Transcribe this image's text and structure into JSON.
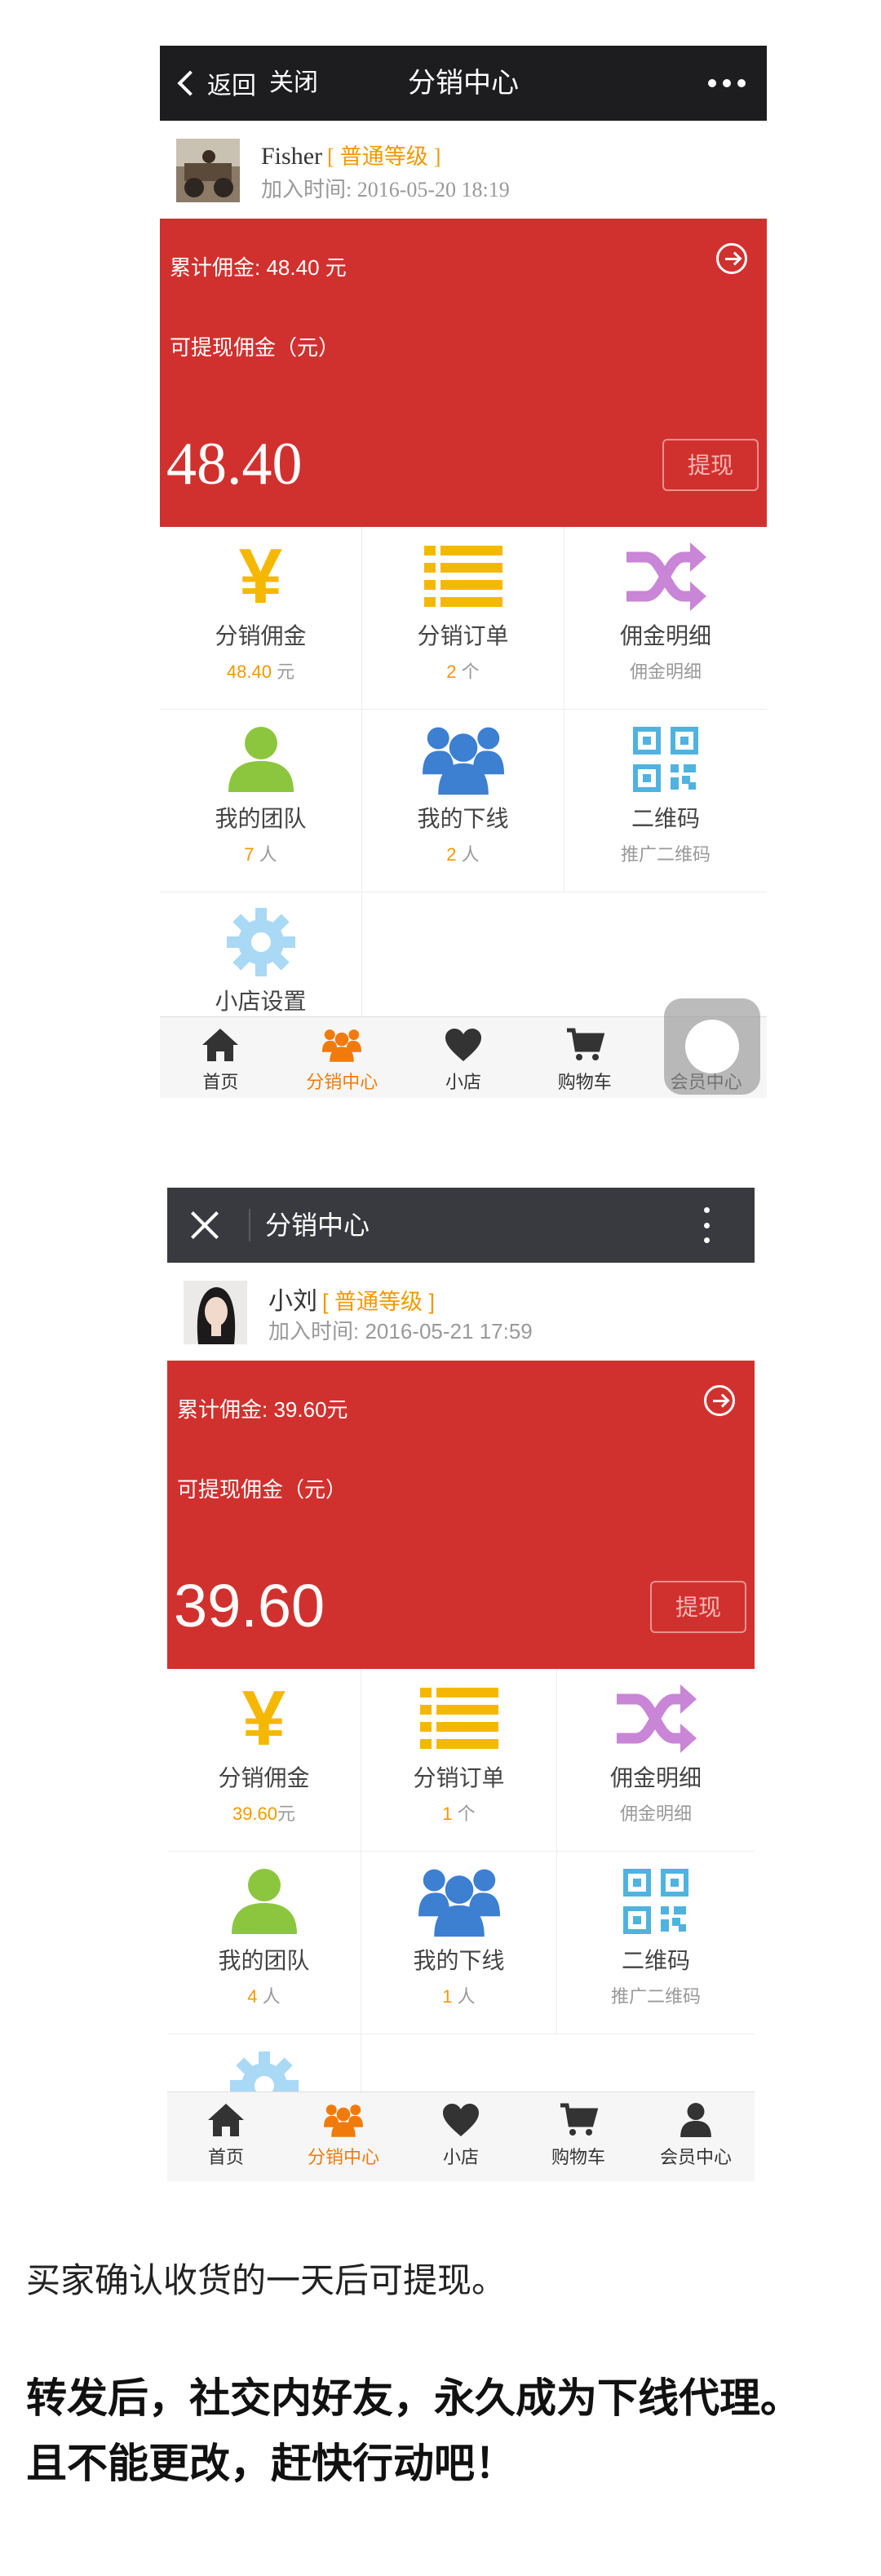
{
  "phone1": {
    "header": {
      "back_label": "返回",
      "close_label": "关闭",
      "title": "分销中心"
    },
    "profile": {
      "name": "Fisher",
      "level": "[ 普通等级 ]",
      "join_label": "加入时间:",
      "join_time": "2016-05-20 18:19"
    },
    "card": {
      "total_label": "累计佣金:",
      "total_value": "48.40 元",
      "available_label": "可提现佣金（元）",
      "available_amount": "48.40",
      "withdraw_label": "提现"
    },
    "grid": {
      "commission_label": "分销佣金",
      "commission_value": "48.40",
      "commission_unit": "元",
      "orders_label": "分销订单",
      "orders_value": "2",
      "orders_unit": "个",
      "details_label": "佣金明细",
      "details_sub": "佣金明细",
      "team_label": "我的团队",
      "team_value": "7",
      "team_unit": "人",
      "downline_label": "我的下线",
      "downline_value": "2",
      "downline_unit": "人",
      "qr_label": "二维码",
      "qr_sub": "推广二维码",
      "shop_label": "小店设置"
    },
    "tabs": [
      "首页",
      "分销中心",
      "小店",
      "购物车",
      "会员中心"
    ]
  },
  "phone2": {
    "header": {
      "title": "分销中心"
    },
    "profile": {
      "name": "小刘",
      "level": "[ 普通等级 ]",
      "join_label": "加入时间:",
      "join_time": "2016-05-21 17:59"
    },
    "card": {
      "total_label": "累计佣金:",
      "total_value": "39.60元",
      "available_label": "可提现佣金（元）",
      "available_amount": "39.60",
      "withdraw_label": "提现"
    },
    "grid": {
      "commission_label": "分销佣金",
      "commission_value": "39.60",
      "commission_unit": "元",
      "orders_label": "分销订单",
      "orders_value": "1",
      "orders_unit": "个",
      "details_label": "佣金明细",
      "details_sub": "佣金明细",
      "team_label": "我的团队",
      "team_value": "4",
      "team_unit": "人",
      "downline_label": "我的下线",
      "downline_value": "1",
      "downline_unit": "人",
      "qr_label": "二维码",
      "qr_sub": "推广二维码"
    },
    "tabs": [
      "首页",
      "分销中心",
      "小店",
      "购物车",
      "会员中心"
    ]
  },
  "notes": {
    "line1": "买家确认收货的一天后可提现。",
    "line2": "转发后，社交内好友，永久成为下线代理。",
    "line3": "且不能更改，赶快行动吧！"
  },
  "colors": {
    "card_red": "#d1312e",
    "accent_orange": "#f39800",
    "tab_active": "#f07b0c",
    "icon_yellow": "#f5b800",
    "icon_purple": "#c985d6",
    "icon_green": "#8cc63e",
    "icon_blue": "#3d7fd1",
    "icon_qr": "#4fb3e0",
    "icon_gear": "#a9d9f5"
  }
}
